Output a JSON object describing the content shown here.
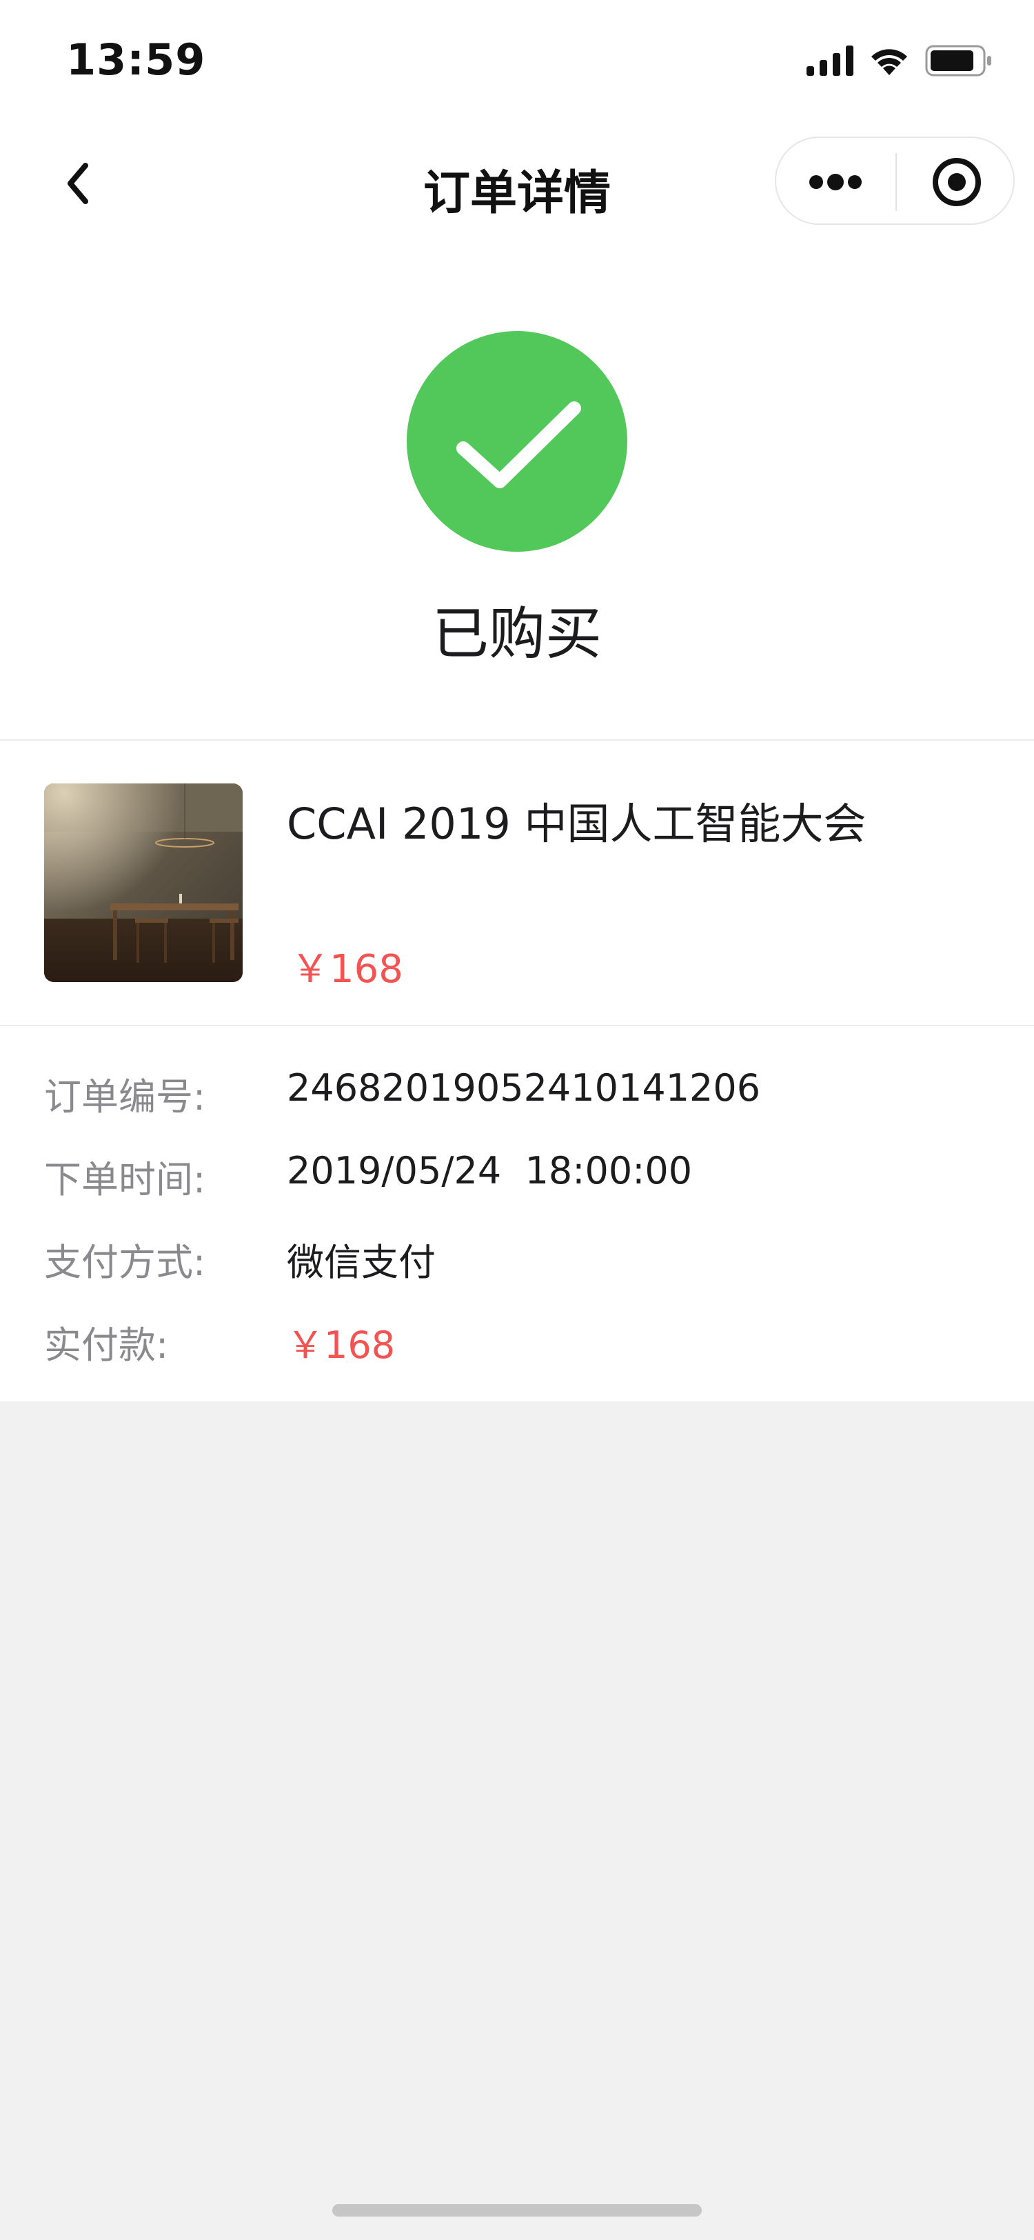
{
  "status_bar": {
    "time": "13:59",
    "icons": [
      "cellular-signal-icon",
      "wifi-icon",
      "battery-icon"
    ]
  },
  "nav": {
    "title": "订单详情",
    "back_icon": "chevron-left-icon",
    "more_icon": "more-dots-icon",
    "close_icon": "target-close-icon"
  },
  "status": {
    "label": "已购买",
    "icon": "check-circle-icon",
    "color": "#52c75a"
  },
  "product": {
    "title": "CCAI 2019 中国人工智能大会",
    "price": "￥168",
    "image": "dim-room-with-table-image"
  },
  "order": {
    "rows": [
      {
        "label": "订单编号:",
        "value": "24682019052410141206"
      },
      {
        "label": "下单时间:",
        "value": "2019/05/24  18:00:00"
      },
      {
        "label": "支付方式:",
        "value": "微信支付"
      },
      {
        "label": "实付款:",
        "value": "￥168"
      }
    ]
  },
  "colors": {
    "accent_price": "#f25454",
    "success_green": "#52c75a",
    "page_background": "#f1f1f1"
  }
}
